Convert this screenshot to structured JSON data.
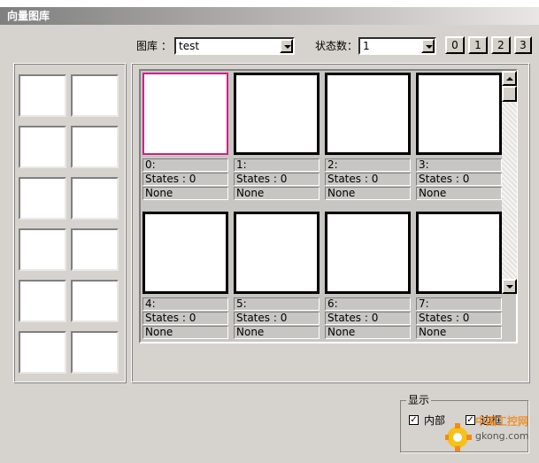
{
  "window": {
    "title": "向量图库"
  },
  "library": {
    "label": "图库 ：",
    "value": "test",
    "state_label": "状态数：",
    "state_value": "1"
  },
  "state_buttons": [
    "0",
    "1",
    "2",
    "3"
  ],
  "gallery": {
    "tiles": [
      {
        "index": "0:",
        "states": "States : 0",
        "name": "None",
        "selected": true
      },
      {
        "index": "1:",
        "states": "States : 0",
        "name": "None"
      },
      {
        "index": "2:",
        "states": "States : 0",
        "name": "None"
      },
      {
        "index": "3:",
        "states": "States : 0",
        "name": "None"
      },
      {
        "index": "4:",
        "states": "States : 0",
        "name": "None"
      },
      {
        "index": "5:",
        "states": "States : 0",
        "name": "None"
      },
      {
        "index": "6:",
        "states": "States : 0",
        "name": "None"
      },
      {
        "index": "7:",
        "states": "States : 0",
        "name": "None"
      }
    ]
  },
  "display": {
    "legend": "显示",
    "options": [
      {
        "label": "内部",
        "checked": true
      },
      {
        "label": "边框",
        "checked": true
      }
    ]
  },
  "watermark": {
    "text": "gkong.com",
    "brand": "中国工控网"
  },
  "colors": {
    "selection": "#d0208a",
    "face": "#d6d3ce",
    "brand_orange": "#f08a1c"
  }
}
